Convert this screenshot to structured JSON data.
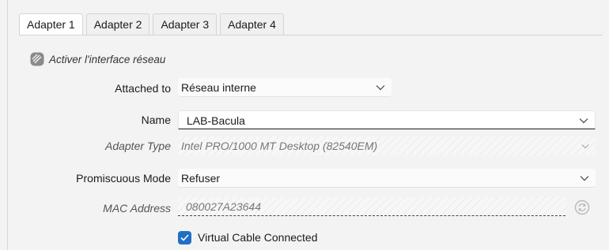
{
  "tabs": [
    {
      "label": "Adapter 1",
      "active": true
    },
    {
      "label": "Adapter 2",
      "active": false
    },
    {
      "label": "Adapter 3",
      "active": false
    },
    {
      "label": "Adapter 4",
      "active": false
    }
  ],
  "enable_adapter": {
    "label": "Activer l'interface réseau",
    "checked": true,
    "disabled": true
  },
  "attached_to": {
    "label": "Attached to",
    "value": "Réseau interne"
  },
  "name": {
    "label": "Name",
    "value": "LAB-Bacula"
  },
  "adapter_type": {
    "label": "Adapter Type",
    "value": "Intel PRO/1000 MT Desktop (82540EM)",
    "disabled": true
  },
  "promiscuous_mode": {
    "label": "Promiscuous Mode",
    "value": "Refuser"
  },
  "mac_address": {
    "label": "MAC Address",
    "value": "080027A23644",
    "disabled": true
  },
  "cable_connected": {
    "label": "Virtual Cable Connected",
    "checked": true
  },
  "colors": {
    "accent": "#1f6fc5",
    "background": "#f3f3f3",
    "disabled_text": "#777777"
  }
}
